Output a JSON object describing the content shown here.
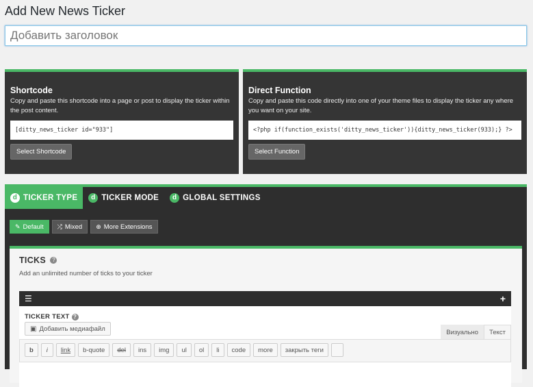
{
  "page": {
    "title": "Add New News Ticker"
  },
  "title_input": {
    "placeholder": "Добавить заголовок"
  },
  "shortcode": {
    "heading": "Shortcode",
    "description": "Copy and paste this shortcode into a page or post to display the ticker within the post content.",
    "code": "[ditty_news_ticker id=\"933\"]",
    "button": "Select Shortcode"
  },
  "direct_function": {
    "heading": "Direct Function",
    "description": "Copy and paste this code directly into one of your theme files to display the ticker any where you want on your site.",
    "code": "<?php if(function_exists('ditty_news_ticker')){ditty_news_ticker(933);} ?>",
    "button": "Select Function"
  },
  "tabs": [
    {
      "label": "TICKER TYPE",
      "icon": "ditty-icon"
    },
    {
      "label": "TICKER MODE",
      "icon": "ditty-icon"
    },
    {
      "label": "GLOBAL SETTINGS",
      "icon": "ditty-icon"
    }
  ],
  "subtabs": [
    {
      "label": "Default",
      "icon": "pencil-icon"
    },
    {
      "label": "Mixed",
      "icon": "shuffle-icon"
    },
    {
      "label": "More Extensions",
      "icon": "plus-circle-icon"
    }
  ],
  "ticks": {
    "heading": "TICKS",
    "description": "Add an unlimited number of ticks to your ticker"
  },
  "tick_item": {
    "label": "TICKER TEXT",
    "media_button": "Добавить медиафайл",
    "visual_tab": "Визуально",
    "text_tab": "Текст",
    "toolbar": [
      "b",
      "i",
      "link",
      "b-quote",
      "del",
      "ins",
      "img",
      "ul",
      "ol",
      "li",
      "code",
      "more",
      "закрыть теги",
      ""
    ]
  },
  "colors": {
    "accent": "#4ab866",
    "dark": "#353535"
  }
}
